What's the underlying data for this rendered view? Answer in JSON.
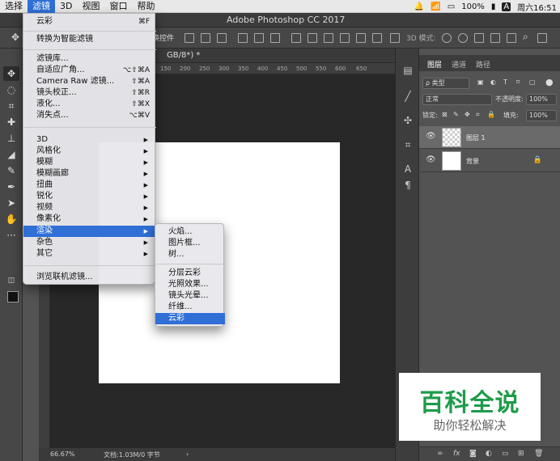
{
  "menubar": {
    "items": [
      "选择",
      "滤镜",
      "3D",
      "视图",
      "窗口",
      "帮助"
    ],
    "battery": "100%",
    "clock": "周六16:51",
    "input_indicator": "A"
  },
  "window": {
    "title": "Adobe Photoshop CC 2017"
  },
  "options_bar": {
    "partial_label": "换控件",
    "mode_label": "3D 模式:"
  },
  "document": {
    "tab_label": "GB/8*) *",
    "ruler_ticks": [
      "150",
      "200",
      "250",
      "300",
      "350",
      "400",
      "450",
      "500",
      "550",
      "600",
      "650"
    ],
    "zoom": "66.67%",
    "doc_info": "文档:1.03M/0 字节"
  },
  "filter_menu": {
    "items": [
      {
        "label": "云彩",
        "shortcut": "⌘F"
      },
      {
        "label": "转换为智能滤镜"
      },
      {
        "label": "滤镜库..."
      },
      {
        "label": "自适应广角...",
        "shortcut": "⌥⇧⌘A"
      },
      {
        "label": "Camera Raw 滤镜...",
        "shortcut": "⇧⌘A"
      },
      {
        "label": "镜头校正...",
        "shortcut": "⇧⌘R"
      },
      {
        "label": "液化...",
        "shortcut": "⇧⌘X"
      },
      {
        "label": "消失点...",
        "shortcut": "⌥⌘V"
      },
      {
        "label": "3D"
      },
      {
        "label": "风格化"
      },
      {
        "label": "模糊"
      },
      {
        "label": "模糊画廊"
      },
      {
        "label": "扭曲"
      },
      {
        "label": "锐化"
      },
      {
        "label": "视频"
      },
      {
        "label": "像素化"
      },
      {
        "label": "渲染"
      },
      {
        "label": "杂色"
      },
      {
        "label": "其它"
      },
      {
        "label": "浏览联机滤镜..."
      }
    ]
  },
  "render_submenu": {
    "items": [
      "火焰...",
      "图片框...",
      "树...",
      "分层云彩",
      "光照效果...",
      "镜头光晕...",
      "纤维...",
      "云彩"
    ]
  },
  "layers_panel": {
    "tabs": [
      "图层",
      "通道",
      "路径"
    ],
    "filter_type": "ρ 类型",
    "blend_mode": "正常",
    "opacity_label": "不透明度:",
    "opacity_value": "100%",
    "lock_label": "锁定:",
    "fill_label": "填充:",
    "fill_value": "100%",
    "layers": [
      {
        "name": "图层 1",
        "selected": true,
        "transparent": true
      },
      {
        "name": "背景",
        "selected": false,
        "transparent": false,
        "locked": true
      }
    ],
    "footer_icons": [
      "link-icon",
      "fx-icon",
      "mask-icon",
      "adjustment-icon",
      "group-icon",
      "new-layer-icon",
      "trash-icon"
    ]
  },
  "watermark": {
    "title": "百科全说",
    "subtitle": "助你轻松解决"
  },
  "colors": {
    "accent": "#2f6fd6",
    "watermark_green": "#1e9b4a"
  }
}
